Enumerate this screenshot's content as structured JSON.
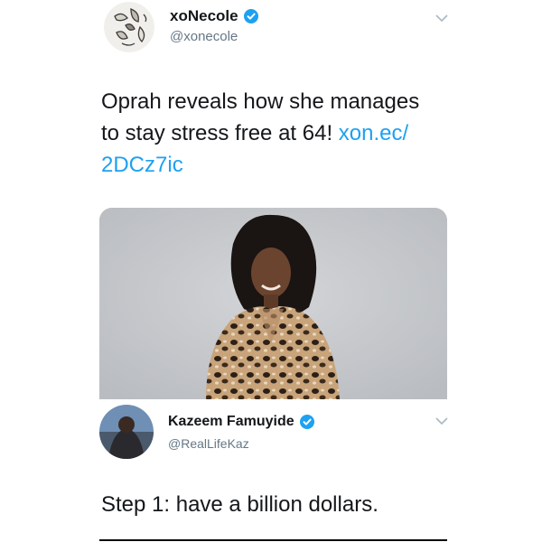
{
  "tweet1": {
    "display_name": "xoNecole",
    "handle": "@xonecole",
    "verified": true,
    "text_parts": {
      "line1": "Oprah reveals how she manages",
      "line2_text": "to stay stress free at 64! ",
      "line2_link": "xon.ec/",
      "line3_link": "2DCz7ic"
    },
    "image": {
      "description_icon": "photo-icon"
    }
  },
  "tweet2": {
    "display_name": "Kazeem Famuyide",
    "handle": "@RealLifeKaz",
    "verified": true,
    "text": "Step 1: have a billion dollars."
  },
  "colors": {
    "link": "#1da1f2",
    "verified": "#1da1f2",
    "secondary_text": "#657786",
    "primary_text": "#14171a"
  }
}
